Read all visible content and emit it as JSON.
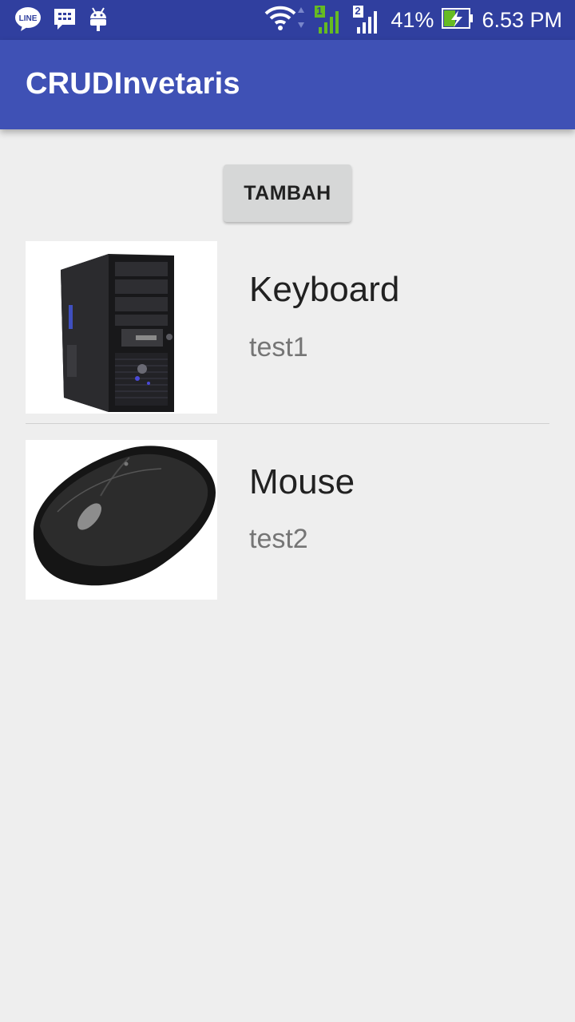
{
  "status_bar": {
    "time": "6.53 PM",
    "battery": "41%",
    "sim1": "1",
    "sim2": "2",
    "left_icons": [
      "line-app-icon",
      "bbm-icon",
      "android-icon"
    ],
    "right_icons": [
      "wifi-icon",
      "signal-sim1-icon",
      "signal-sim2-icon",
      "battery-charging-icon"
    ]
  },
  "app_bar": {
    "title": "CRUDInvetaris"
  },
  "actions": {
    "add_label": "TAMBAH"
  },
  "items": [
    {
      "name": "Keyboard",
      "description": "test1",
      "image": "pc-tower-image"
    },
    {
      "name": "Mouse",
      "description": "test2",
      "image": "computer-mouse-image"
    }
  ],
  "colors": {
    "primary": "#3f51b5",
    "primary_dark": "#303f9f",
    "background": "#eeeeee",
    "button": "#d6d7d7"
  }
}
